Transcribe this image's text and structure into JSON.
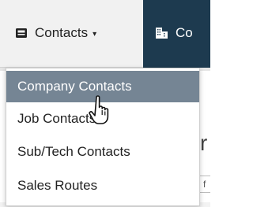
{
  "nav": {
    "contacts_label": "Contacts",
    "contacts_caret": "▾",
    "companies_label_visible": "Co",
    "colors": {
      "bar": "#1d3a4f",
      "active_tab": "#f1f1f1"
    }
  },
  "menu": {
    "items": [
      {
        "label": "Company Contacts",
        "state": "highlighted"
      },
      {
        "label": "Job Contacts",
        "state": "normal"
      },
      {
        "label": "Sub/Tech Contacts",
        "state": "normal"
      },
      {
        "label": "Sales Routes",
        "state": "normal"
      }
    ],
    "colors": {
      "highlight": "#758594"
    }
  },
  "background": {
    "glyph_r": "r",
    "field_glyph": "f"
  },
  "icons": {
    "contacts": "address-card-icon",
    "companies": "building-icon",
    "cursor": "hand-pointer-cursor"
  }
}
